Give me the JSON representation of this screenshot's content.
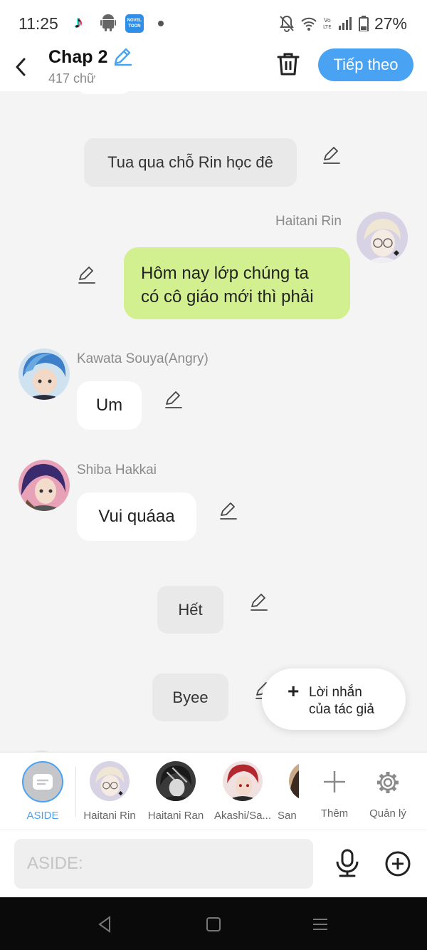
{
  "status_bar": {
    "time": "11:25",
    "novel_icon_text": "NOVEL TOON",
    "battery": "27%"
  },
  "header": {
    "title": "Chap 2",
    "word_count": "417 chữ",
    "next_label": "Tiếp theo"
  },
  "messages": {
    "aside_1": "Tua qua chỗ Rin học đê",
    "rin_name": "Haitani Rin",
    "rin_line1": "Hôm nay lớp chúng ta",
    "rin_line2": "có cô giáo mới thì phải",
    "souya_name": "Kawata Souya(Angry)",
    "souya_text": "Um",
    "hakkai_name": "Shiba Hakkai",
    "hakkai_text": "Vui quáaa",
    "aside_2": "Hết",
    "aside_3": "Byee"
  },
  "author_note": {
    "line1": "Lời nhắn",
    "line2": "của tác giả"
  },
  "characters": [
    {
      "label": "ASIDE"
    },
    {
      "label": "Haitani Rin"
    },
    {
      "label": "Haitani Ran"
    },
    {
      "label": "Akashi/Sa..."
    },
    {
      "label": "San"
    }
  ],
  "actions": {
    "more_label": "Thêm",
    "manage_label": "Quản lý"
  },
  "input": {
    "placeholder": "ASIDE:"
  },
  "colors": {
    "accent": "#4aa3f2",
    "green_bubble": "#d2f090",
    "aside_bubble": "#e9e9ea"
  }
}
